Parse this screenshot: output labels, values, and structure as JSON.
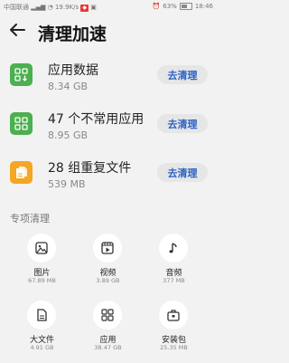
{
  "status_bar": {
    "carrier": "中国联通",
    "speed": "19.9K/s",
    "battery": "63%",
    "time": "18:46"
  },
  "header": {
    "title": "清理加速"
  },
  "cards": [
    {
      "title": "应用数据",
      "size": "8.34 GB",
      "button": "去清理",
      "icon": "app-data-icon",
      "color": "#4caf50"
    },
    {
      "title": "47 个不常用应用",
      "size": "8.95 GB",
      "button": "去清理",
      "icon": "grid-apps-icon",
      "color": "#4caf50"
    },
    {
      "title": "28 组重复文件",
      "size": "539 MB",
      "button": "去清理",
      "icon": "duplicate-files-icon",
      "color": "#f5a623"
    }
  ],
  "special": {
    "section_title": "专项清理",
    "items": [
      {
        "label": "图片",
        "size": "67.89 MB",
        "icon": "image-icon"
      },
      {
        "label": "视频",
        "size": "3.89 GB",
        "icon": "video-icon"
      },
      {
        "label": "音频",
        "size": "377 MB",
        "icon": "music-icon"
      },
      {
        "label": "大文件",
        "size": "4.91 GB",
        "icon": "file-icon"
      },
      {
        "label": "应用",
        "size": "38.47 GB",
        "icon": "apps-icon"
      },
      {
        "label": "安装包",
        "size": "25.35 MB",
        "icon": "package-icon"
      }
    ]
  }
}
